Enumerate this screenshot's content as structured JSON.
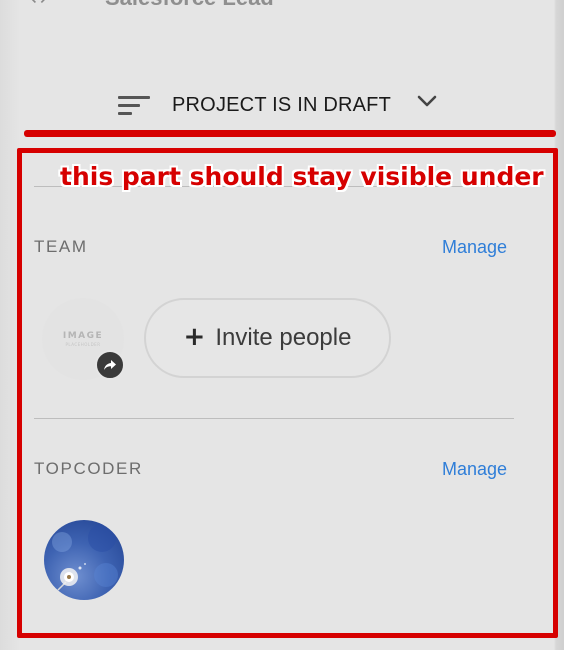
{
  "header": {
    "title": "Salesforce Lead",
    "icon": "link-icon"
  },
  "status": {
    "label": "PROJECT IS IN DRAFT",
    "menu_icon": "align-left-icon",
    "dropdown_icon": "chevron-down-icon"
  },
  "annotation": {
    "text": "this part should stay visible under",
    "color": "#d60000"
  },
  "team": {
    "label": "TEAM",
    "manage_label": "Manage",
    "avatar_placeholder": "IMAGE",
    "avatar_placeholder_sub": "PLACEHOLDER",
    "badge_icon": "share-icon",
    "invite_label": "Invite people",
    "invite_icon": "plus-icon"
  },
  "topcoder": {
    "label": "TOPCODER",
    "manage_label": "Manage",
    "avatar": "dandelion-photo"
  },
  "colors": {
    "link": "#2f7ed8",
    "background": "#e5e5e5",
    "annotation": "#d60000"
  }
}
